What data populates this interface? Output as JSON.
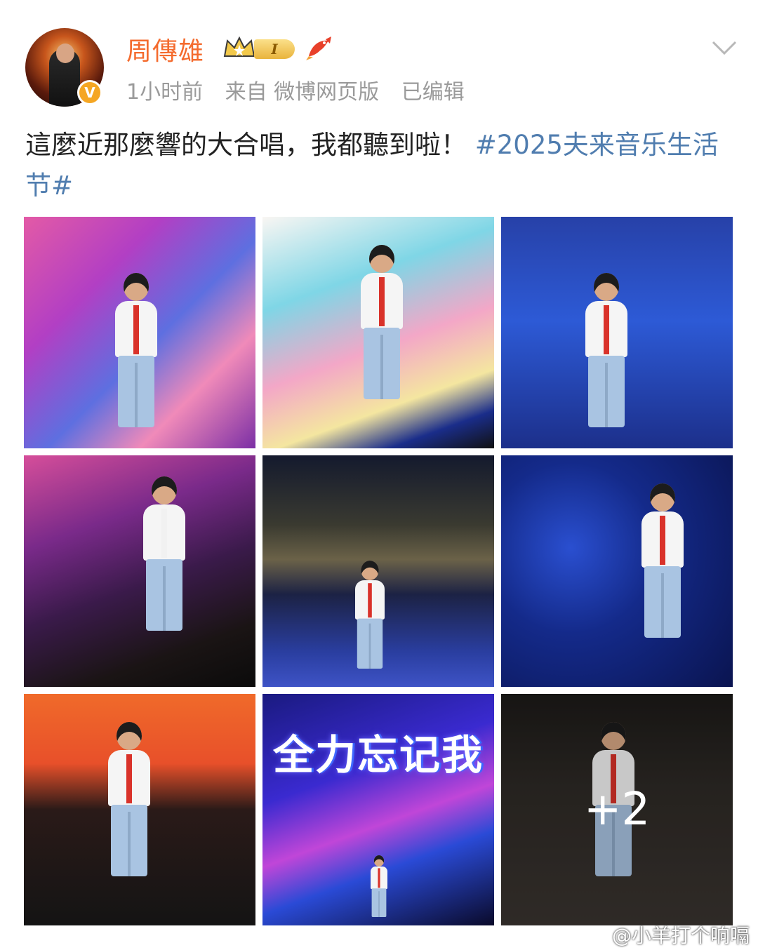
{
  "user": {
    "name": "周傳雄",
    "level_badge": "I",
    "verified_badge": "V"
  },
  "meta": {
    "time": "1小时前",
    "source": "来自 微博网页版",
    "edited": "已编辑"
  },
  "post": {
    "text": "這麼近那麼響的大合唱，我都聽到啦！",
    "hashtag": "#2025夫来音乐生活节#"
  },
  "photos": [
    {
      "icon": "concert-photo-1"
    },
    {
      "icon": "concert-photo-2"
    },
    {
      "icon": "concert-photo-3"
    },
    {
      "icon": "concert-photo-4"
    },
    {
      "icon": "concert-photo-5"
    },
    {
      "icon": "concert-photo-6"
    },
    {
      "icon": "concert-photo-7"
    },
    {
      "icon": "concert-photo-8",
      "screen_text": "全力忘记我"
    },
    {
      "icon": "concert-photo-9",
      "more_count": "+2"
    }
  ],
  "watermark": {
    "text": "@小羊打个响嗝"
  },
  "colors": {
    "username": "#f46b2e",
    "hashtag": "#507daf",
    "meta": "#9a9a9a"
  }
}
